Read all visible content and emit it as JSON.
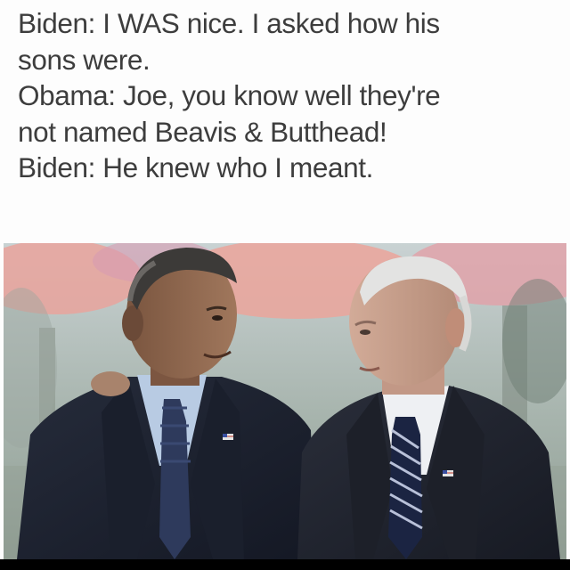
{
  "caption": {
    "lines": [
      "Biden: I WAS nice. I asked how his",
      "sons were.",
      "Obama: Joe, you know well they're",
      "not named Beavis & Butthead!",
      "Biden: He knew who I meant."
    ]
  },
  "photo": {
    "colors": {
      "background_trees": "#7f8d84",
      "awning_pink": "#e7a09d",
      "suit_dark": "#1c2230",
      "skin": "#c79d86",
      "shirt_blue": "#b8cbe3",
      "hair_white": "#e3e3e2"
    },
    "icons": [
      "flag-pin-icon-left",
      "flag-pin-icon-right"
    ]
  }
}
